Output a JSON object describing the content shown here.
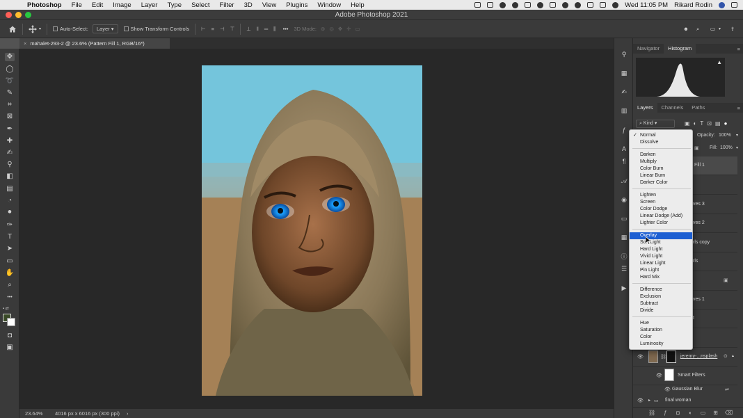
{
  "menubar": {
    "app_name": "Photoshop",
    "items": [
      "File",
      "Edit",
      "Image",
      "Layer",
      "Type",
      "Select",
      "Filter",
      "3D",
      "View",
      "Plugins",
      "Window",
      "Help"
    ],
    "clock": "Wed 11:05 PM",
    "user": "Rikard Rodin",
    "apple_icon": "apple-icon"
  },
  "window": {
    "title": "Adobe Photoshop 2021"
  },
  "options_bar": {
    "auto_select_label": "Auto-Select:",
    "auto_select_target": "Layer",
    "transform_controls_label": "Show Transform Controls",
    "mode_3d_label": "3D Mode:",
    "more_label": "•••"
  },
  "document": {
    "tab_title": "mahalet-293-2 @ 23.6% (Pattern Fill 1, RGB/16*)",
    "close_label": "×",
    "zoom": "23.64%",
    "size_info": "4016 px x 6016 px (300 ppi)",
    "status_arrow": "›"
  },
  "toolbox": {
    "tools": [
      {
        "name": "move-tool-icon",
        "glyph": "✥"
      },
      {
        "name": "marquee-tool-icon",
        "glyph": "◯"
      },
      {
        "name": "lasso-tool-icon",
        "glyph": "➰"
      },
      {
        "name": "quick-select-tool-icon",
        "glyph": "✎"
      },
      {
        "name": "crop-tool-icon",
        "glyph": "⌗"
      },
      {
        "name": "frame-tool-icon",
        "glyph": "⊠"
      },
      {
        "name": "eyedropper-tool-icon",
        "glyph": "✒"
      },
      {
        "name": "healing-brush-tool-icon",
        "glyph": "✚"
      },
      {
        "name": "brush-tool-icon",
        "glyph": "✍"
      },
      {
        "name": "clone-stamp-tool-icon",
        "glyph": "⚲"
      },
      {
        "name": "eraser-tool-icon",
        "glyph": "◧"
      },
      {
        "name": "gradient-tool-icon",
        "glyph": "▤"
      },
      {
        "name": "blur-tool-icon",
        "glyph": "💧"
      },
      {
        "name": "dodge-tool-icon",
        "glyph": "⚫"
      },
      {
        "name": "pen-tool-icon",
        "glyph": "✑"
      },
      {
        "name": "type-tool-icon",
        "glyph": "T"
      },
      {
        "name": "path-select-tool-icon",
        "glyph": "➤"
      },
      {
        "name": "shape-tool-icon",
        "glyph": "▭"
      },
      {
        "name": "hand-tool-icon",
        "glyph": "✋"
      },
      {
        "name": "zoom-tool-icon",
        "glyph": "⌕"
      },
      {
        "name": "more-tools-icon",
        "glyph": "•••"
      }
    ]
  },
  "panels": {
    "top_tabs": [
      "Navigator",
      "Histogram"
    ],
    "layers_tabs": [
      "Layers",
      "Channels",
      "Paths"
    ],
    "filter_kind": "Kind",
    "opacity_label": "Opacity:",
    "opacity_value": "100%",
    "fill_label": "Fill:",
    "fill_value": "100%",
    "layers": [
      {
        "name": "Pattern Fill 1",
        "visible_text": "ern Fill 1"
      },
      {
        "name": "ent",
        "visible_text": "ent"
      },
      {
        "name": "Curves 3",
        "visible_text": "ves 3"
      },
      {
        "name": "Curves 2",
        "visible_text": "ves 2"
      },
      {
        "name": "Curls copy",
        "visible_text": "rls copy"
      },
      {
        "name": "Curls",
        "visible_text": "rls"
      },
      {
        "name": "Curves 1",
        "visible_text": "ves 1"
      },
      {
        "name": "t",
        "visible_text": "t"
      },
      {
        "name": "ent2",
        "visible_text": "ent"
      },
      {
        "name": "jeremy-...nsplash",
        "visible_text": "jeremy-...nsplash"
      },
      {
        "name": "Smart Filters",
        "visible_text": "Smart Filters"
      },
      {
        "name": "Gaussian Blur",
        "visible_text": "Gaussian Blur"
      },
      {
        "name": "final woman",
        "visible_text": "final woman"
      }
    ]
  },
  "blend_menu": {
    "selected": "Overlay",
    "checked": "Normal",
    "checkmark": "✓",
    "groups": [
      [
        "Normal",
        "Dissolve"
      ],
      [
        "Darken",
        "Multiply",
        "Color Burn",
        "Linear Burn",
        "Darker Color"
      ],
      [
        "Lighten",
        "Screen",
        "Color Dodge",
        "Linear Dodge (Add)",
        "Lighter Color"
      ],
      [
        "Overlay",
        "Soft Light",
        "Hard Light",
        "Vivid Light",
        "Linear Light",
        "Pin Light",
        "Hard Mix"
      ],
      [
        "Difference",
        "Exclusion",
        "Subtract",
        "Divide"
      ],
      [
        "Hue",
        "Saturation",
        "Color",
        "Luminosity"
      ]
    ]
  },
  "colors": {
    "accent": "#1d5fd2",
    "panel": "#3a3a3a",
    "canvas": "#282828"
  }
}
